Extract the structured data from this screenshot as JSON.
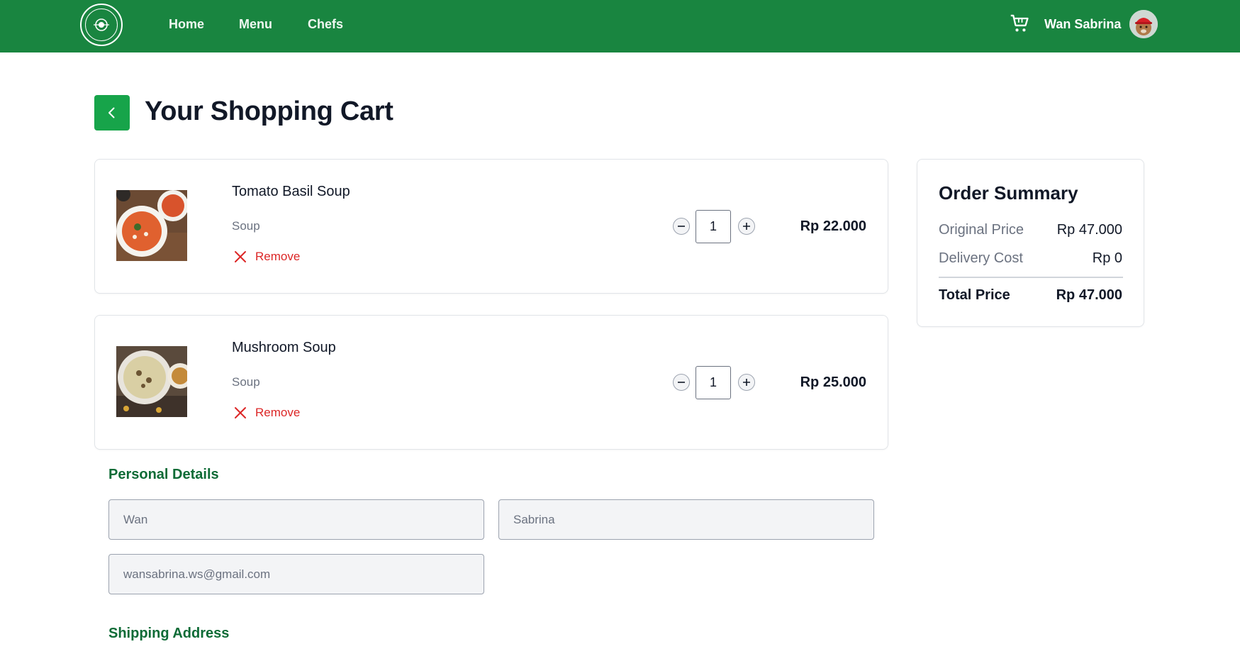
{
  "colors": {
    "header_bg": "#198540",
    "accent": "#17a44a",
    "section_title": "#0e6b36",
    "remove": "#dc2626"
  },
  "header": {
    "logo_icon": "restaurant-logo-icon",
    "nav": [
      {
        "label": "Home"
      },
      {
        "label": "Menu"
      },
      {
        "label": "Chefs"
      }
    ],
    "cart_icon": "shopping-cart-icon",
    "user_name": "Wan Sabrina"
  },
  "page": {
    "back_icon": "chevron-left-icon",
    "title": "Your Shopping Cart"
  },
  "cart": {
    "items": [
      {
        "name": "Tomato Basil Soup",
        "category": "Soup",
        "remove_label": "Remove",
        "quantity": "1",
        "price": "Rp 22.000"
      },
      {
        "name": "Mushroom Soup",
        "category": "Soup",
        "remove_label": "Remove",
        "quantity": "1",
        "price": "Rp 25.000"
      }
    ]
  },
  "summary": {
    "title": "Order Summary",
    "original_label": "Original Price",
    "original_value": "Rp 47.000",
    "delivery_label": "Delivery Cost",
    "delivery_value": "Rp 0",
    "total_label": "Total Price",
    "total_value": "Rp 47.000"
  },
  "personal": {
    "title": "Personal Details",
    "first_name": "Wan",
    "last_name": "Sabrina",
    "email": "wansabrina.ws@gmail.com"
  },
  "shipping": {
    "title": "Shipping Address"
  }
}
